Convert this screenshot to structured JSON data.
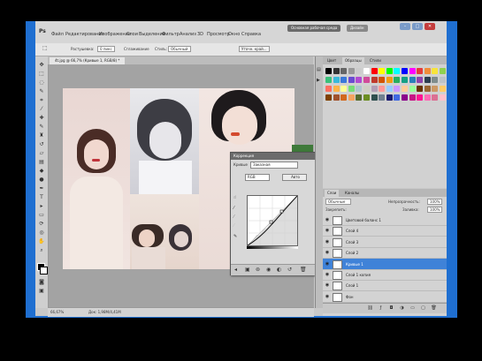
{
  "menubar": {
    "brand": "Ps",
    "items": [
      "Файл",
      "Редактирование",
      "Изображение",
      "Слои",
      "Выделение",
      "Фильтр",
      "Анализ",
      "3D",
      "Просмотр",
      "Окно",
      "Справка"
    ],
    "workspace_labels": [
      "Основная рабочая среда",
      "Дизайн"
    ],
    "window_buttons": [
      "–",
      "□",
      "✕"
    ]
  },
  "options_bar": {
    "items": [
      "Растушевка:",
      "0 пикс",
      "Сглаживание",
      "Стиль:",
      "Обычный",
      "Уточн. край..."
    ]
  },
  "document": {
    "tab_title": "4t.jpg @ 66,7% (Кривые 1, RGB/8) *"
  },
  "statusbar": {
    "zoom": "66,67%",
    "info": "Док: 1,98M/4,41M"
  },
  "curves_dialog": {
    "title": "Коррекция",
    "preset_label": "Кривые",
    "preset_value": "Заказная",
    "channel_value": "RGB",
    "auto_label": "Авто"
  },
  "swatches_panel": {
    "tabs": [
      "Цвет",
      "Образцы",
      "Стили"
    ],
    "colors": [
      "#000000",
      "#333333",
      "#666666",
      "#999999",
      "#cccccc",
      "#ffffff",
      "#ff0000",
      "#ffff00",
      "#00ff00",
      "#00ffff",
      "#0000ff",
      "#ff00ff",
      "#e43b3b",
      "#f08c3a",
      "#f7e43a",
      "#8fd14f",
      "#3ac07a",
      "#3ab9d9",
      "#3a78d9",
      "#6a4bd1",
      "#b14bd1",
      "#d14b9a",
      "#c0392b",
      "#d35400",
      "#f39c12",
      "#27ae60",
      "#16a085",
      "#2980b9",
      "#8e44ad",
      "#2c3e50",
      "#7f8c8d",
      "#bdc3c7",
      "#ff6f61",
      "#ffb347",
      "#fdfd96",
      "#77dd77",
      "#aec6cf",
      "#cfcfc4",
      "#b39eb5",
      "#ff9999",
      "#99ccff",
      "#cc99ff",
      "#ffcc99",
      "#99ff99",
      "#663300",
      "#996633",
      "#cc9966",
      "#ffcc66",
      "#804000",
      "#a0522d",
      "#d2691e",
      "#f4a460",
      "#556b2f",
      "#6b8e23",
      "#2f4f4f",
      "#708090",
      "#191970",
      "#4169e1",
      "#8b008b",
      "#c71585",
      "#ff1493",
      "#ff69b4",
      "#db7093",
      "#ffc0cb"
    ]
  },
  "layers_panel": {
    "tabs": [
      "Слои",
      "Каналы"
    ],
    "blend_mode": "Обычные",
    "opacity_label": "Непрозрачность:",
    "opacity_value": "100%",
    "lock_label": "Закрепить:",
    "fill_label": "Заливка:",
    "fill_value": "100%",
    "layers": [
      {
        "name": "Цветовой баланс 1",
        "selected": false
      },
      {
        "name": "Слой 4",
        "selected": false
      },
      {
        "name": "Слой 3",
        "selected": false
      },
      {
        "name": "Слой 2",
        "selected": false
      },
      {
        "name": "Кривые 1",
        "selected": true
      },
      {
        "name": "Слой 1 копия",
        "selected": false
      },
      {
        "name": "Слой 1",
        "selected": false
      },
      {
        "name": "Фон",
        "selected": false
      }
    ]
  },
  "colors": {
    "desktop_blue": "#1f6fd1",
    "selection_blue": "#3f82d8"
  }
}
